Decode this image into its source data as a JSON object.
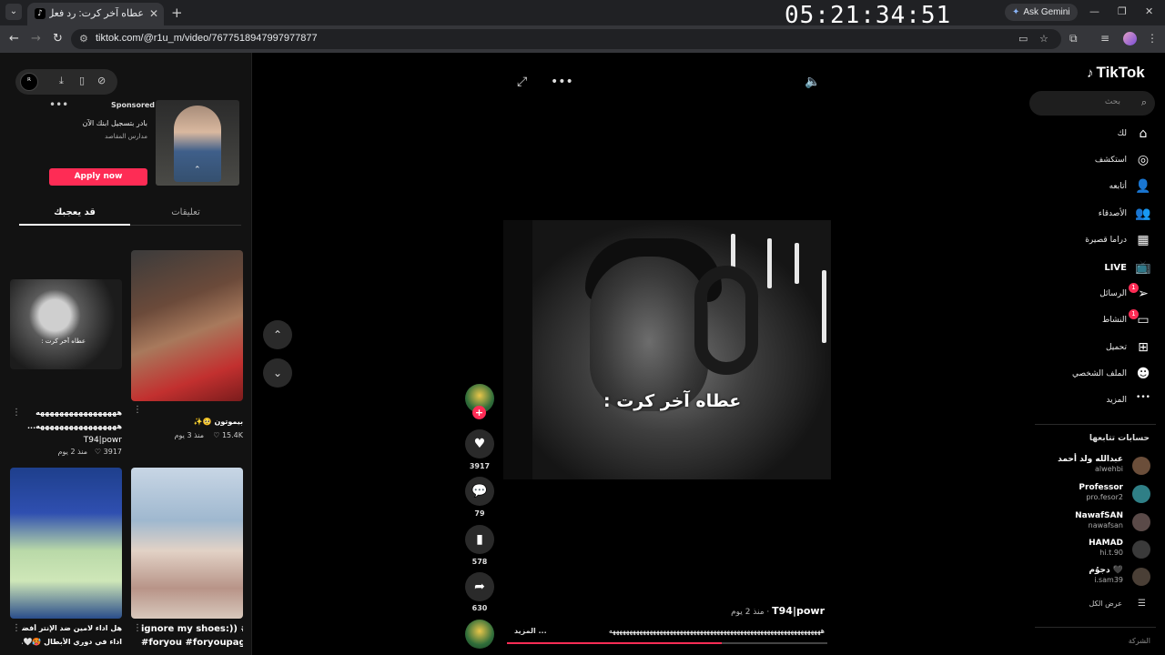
{
  "browser": {
    "tab_title": "عطاه آخر كرت: رد فعل طريف",
    "clock": "05:21:34:51",
    "gemini_label": "Ask Gemini",
    "url": "tiktok.com/@r1u_m/video/7677518947997977877"
  },
  "left_panel": {
    "ad": {
      "sponsored": "Sponsored",
      "headline": "بادر بتسجيل ابنك الآن",
      "sub": "مدارس المقاصد",
      "apply": "Apply now"
    },
    "tabs": {
      "comments": "تعليقات",
      "you_may_like": "قد يعجبك"
    },
    "cards": [
      {
        "thumb_caption": "عطاه آخر كرت :",
        "desc_line1": "هههههههههههههههههه",
        "desc_line2": "هههههههههههههههههه...",
        "author": "T94|powr",
        "likes": "3917",
        "time": "منذ 2 يوم"
      },
      {
        "desc_line1": "بيموتون 🥺✨",
        "likes": "15.4K",
        "time": "منذ 3 يوم"
      },
      {
        "desc_line1": "هل اداء لامين ضد الإنتر أفضل",
        "desc_line2": "اداء في دوري الأبطال 🥵🤍..."
      },
      {
        "desc_line1": "ignore my shoes:)) #fyp",
        "desc_line2": "#foryou #foryoupage"
      }
    ]
  },
  "video": {
    "caption": "عطاه آخر كرت :",
    "likes": "3917",
    "comments": "79",
    "saves": "578",
    "shares": "630",
    "author": "T94|powr",
    "time": "منذ 2 يوم",
    "description": "هههههههههههههههههههههههههههههههههههههههههههههههههههههههههههههههه",
    "more_label": "المزيد ...",
    "progress": 0.67
  },
  "sidebar": {
    "logo": "TikTok",
    "search_placeholder": "بحث",
    "nav": [
      {
        "label": "لك",
        "icon": "home-icon"
      },
      {
        "label": "استكشف",
        "icon": "compass-icon"
      },
      {
        "label": "أتابعه",
        "icon": "user-follow-icon"
      },
      {
        "label": "الأصدقاء",
        "icon": "friends-icon"
      },
      {
        "label": "دراما قصيرة",
        "icon": "film-icon"
      },
      {
        "label": "LIVE",
        "icon": "live-icon"
      },
      {
        "label": "الرسائل",
        "icon": "send-icon",
        "badge": "1"
      },
      {
        "label": "النشاط",
        "icon": "chat-icon",
        "badge": "1"
      },
      {
        "label": "تحميل",
        "icon": "upload-icon"
      },
      {
        "label": "الملف الشخصي",
        "icon": "profile-icon"
      },
      {
        "label": "المزيد",
        "icon": "more-icon"
      }
    ],
    "following_title": "حسابات تتابعها",
    "following": [
      {
        "name": "عبدالله ولد أحمد",
        "user": "alwehbi",
        "color": "#6b4e3a"
      },
      {
        "name": "Professor",
        "user": "pro.fesor2",
        "color": "#2f7f86"
      },
      {
        "name": "NawafSAN",
        "user": "nawafsan",
        "color": "#5a4a48"
      },
      {
        "name": "HAMAD",
        "user": "hi.t.90",
        "color": "#3a3a3a"
      },
      {
        "name": "دجوُم 🖤",
        "user": "i.sam39",
        "color": "#4a3f36"
      }
    ],
    "see_all": "عرض الكل",
    "company": "الشركة"
  },
  "colors": {
    "accent": "#fe2c55",
    "background": "#000000",
    "panel": "#121212"
  }
}
